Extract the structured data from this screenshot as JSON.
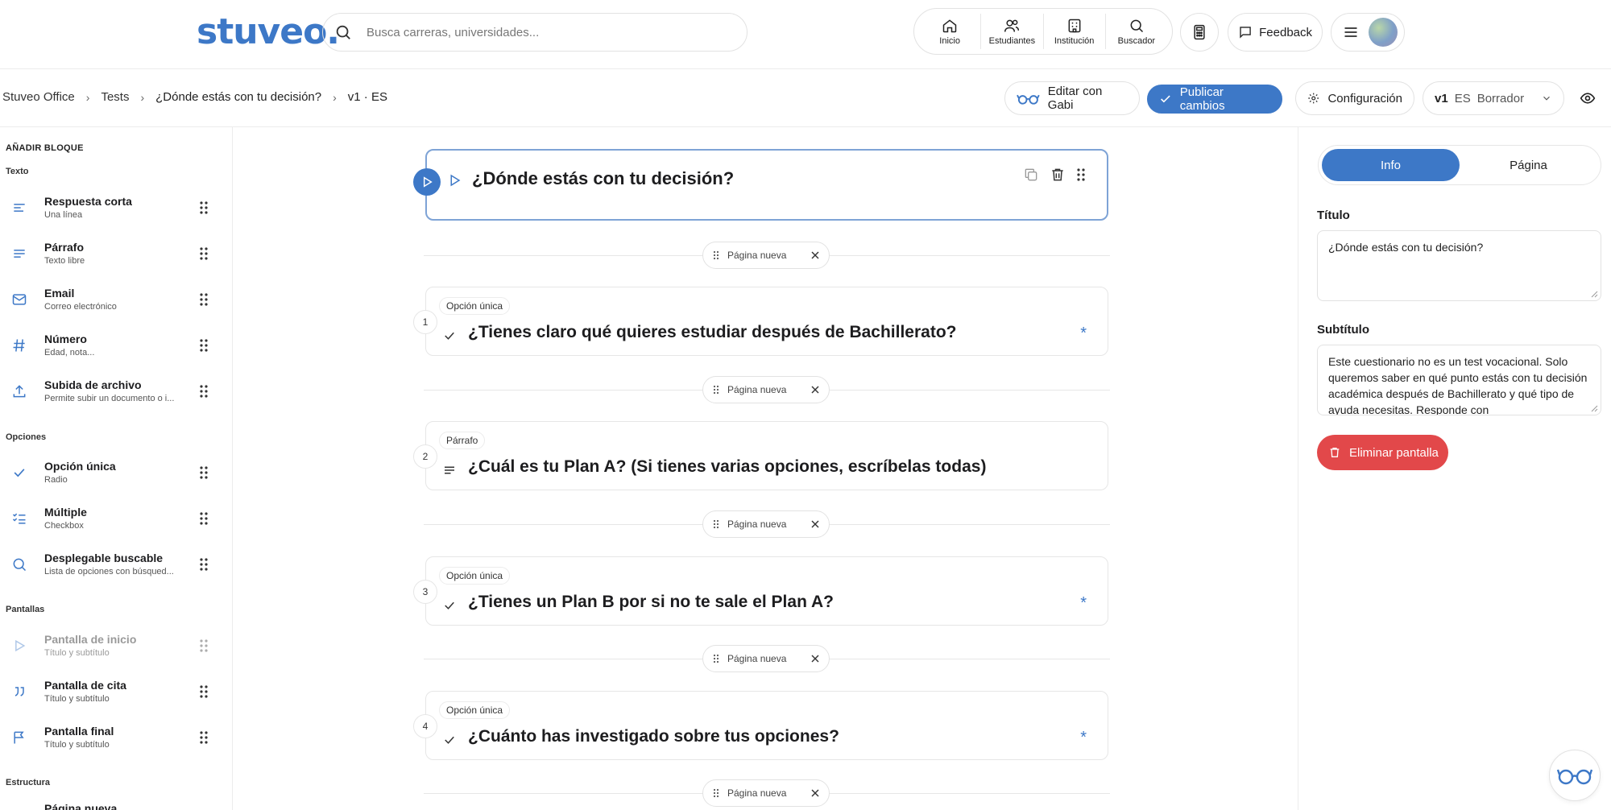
{
  "brand": {
    "logo": "stuveo.",
    "accent": "#3d78c7",
    "danger": "#e2484a"
  },
  "search": {
    "placeholder": "Busca carreras, universidades..."
  },
  "nav": [
    {
      "label": "Inicio",
      "icon": "home-icon"
    },
    {
      "label": "Estudiantes",
      "icon": "users-icon"
    },
    {
      "label": "Institución",
      "icon": "building-icon"
    },
    {
      "label": "Buscador",
      "icon": "search-icon"
    }
  ],
  "header": {
    "feedback_label": "Feedback"
  },
  "breadcrumb": [
    "Stuveo Office",
    "Tests",
    "¿Dónde estás con tu decisión?",
    "v1 · ES"
  ],
  "toolbar": {
    "edit_gabi": "Editar con Gabi",
    "publish": "Publicar cambios",
    "config": "Configuración",
    "version": "v1",
    "lang": "ES",
    "status": "Borrador"
  },
  "sidebar": {
    "title": "AÑADIR BLOQUE",
    "sections": {
      "texto": "Texto",
      "opciones": "Opciones",
      "pantallas": "Pantallas",
      "estructura": "Estructura"
    },
    "blocks": [
      {
        "name": "Respuesta corta",
        "sub": "Una línea",
        "icon": "short-answer-icon"
      },
      {
        "name": "Párrafo",
        "sub": "Texto libre",
        "icon": "paragraph-icon"
      },
      {
        "name": "Email",
        "sub": "Correo electrónico",
        "icon": "mail-icon"
      },
      {
        "name": "Número",
        "sub": "Edad, nota...",
        "icon": "hash-icon"
      },
      {
        "name": "Subida de archivo",
        "sub": "Permite subir un documento o i...",
        "icon": "upload-icon"
      },
      {
        "name": "Opción única",
        "sub": "Radio",
        "icon": "check-icon"
      },
      {
        "name": "Múltiple",
        "sub": "Checkbox",
        "icon": "checklist-icon"
      },
      {
        "name": "Desplegable buscable",
        "sub": "Lista de opciones con búsqued...",
        "icon": "search-icon"
      },
      {
        "name": "Pantalla de inicio",
        "sub": "Título y subtítulo",
        "icon": "play-icon"
      },
      {
        "name": "Pantalla de cita",
        "sub": "Título y subtítulo",
        "icon": "quote-icon"
      },
      {
        "name": "Pantalla final",
        "sub": "Título y subtítulo",
        "icon": "flag-icon"
      },
      {
        "name": "Página nueva",
        "sub": "",
        "icon": "page-icon"
      }
    ]
  },
  "canvas": {
    "welcome_title": "¿Dónde estás con tu decisión?",
    "page_break_label": "Página nueva",
    "questions": [
      {
        "num": "1",
        "type": "Opción única",
        "text": "¿Tienes claro qué quieres estudiar después de Bachillerato?",
        "required": "*"
      },
      {
        "num": "2",
        "type": "Párrafo",
        "text": "¿Cuál es tu Plan A? (Si tienes varias opciones, escríbelas todas)",
        "required": ""
      },
      {
        "num": "3",
        "type": "Opción única",
        "text": "¿Tienes un Plan B por si no te sale el Plan A?",
        "required": "*"
      },
      {
        "num": "4",
        "type": "Opción única",
        "text": "¿Cuánto has investigado sobre tus opciones?",
        "required": "*"
      }
    ]
  },
  "panel": {
    "tabs": [
      "Info",
      "Página"
    ],
    "title_label": "Título",
    "title_value": "¿Dónde estás con tu decisión?",
    "subtitle_label": "Subtítulo",
    "subtitle_value": "Este cuestionario no es un test vocacional. Solo queremos saber en qué punto estás con tu decisión académica después de Bachillerato y qué tipo de ayuda necesitas. Responde con",
    "delete_label": "Eliminar pantalla"
  }
}
